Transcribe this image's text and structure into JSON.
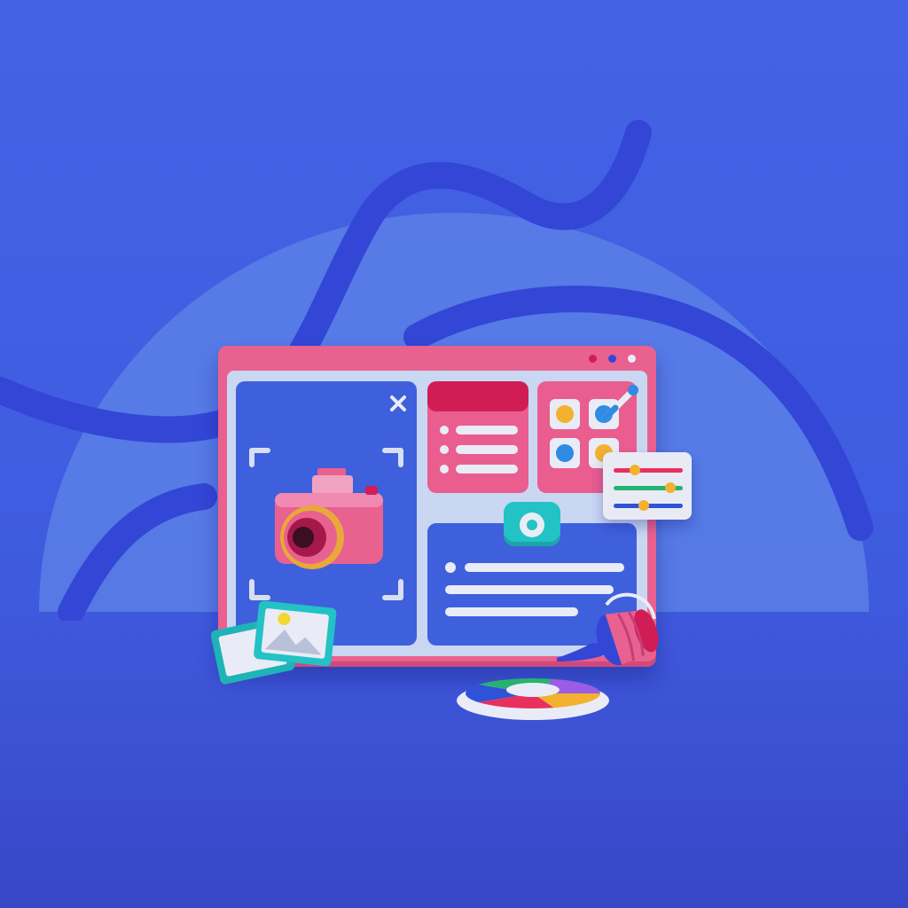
{
  "scene": {
    "description_free": true,
    "icons": [
      "close-icon",
      "camera-icon",
      "picture-frame-icon",
      "paint-bucket-icon",
      "color-wheel-icon",
      "eyedropper-icon",
      "sliders-icon",
      "toggle-icon",
      "focus-bracket-icon"
    ]
  },
  "colors": {
    "background": "#4462e4",
    "window_frame": "#e8618f",
    "window_body": "#c9d7f3",
    "pane_blue": "#3f60dd",
    "pane_pink": "#ea5d8f",
    "accent_crimson": "#d01d55",
    "accent_teal": "#22c2c5",
    "accent_yellow": "#f2b12e",
    "tube": "#3346d6",
    "arc": "#5b7fe6"
  },
  "window": {
    "controls": [
      "#d01d55",
      "#3346d6",
      "#e9ecf6"
    ]
  },
  "grid_palette": {
    "swatches": [
      "#f2b12e",
      "#2f8be4",
      "#2f8be4",
      "#f2b12e"
    ]
  },
  "slider_panel": {
    "rows": [
      {
        "color": "#e8305e",
        "level": 0.25
      },
      {
        "color": "#26b36f",
        "level": 0.75
      },
      {
        "color": "#2f52d8",
        "level": 0.4
      }
    ]
  },
  "color_wheel": {
    "segments": [
      "#f2b12e",
      "#e8305e",
      "#2f52d8",
      "#26b36f",
      "#9b5de5"
    ]
  }
}
